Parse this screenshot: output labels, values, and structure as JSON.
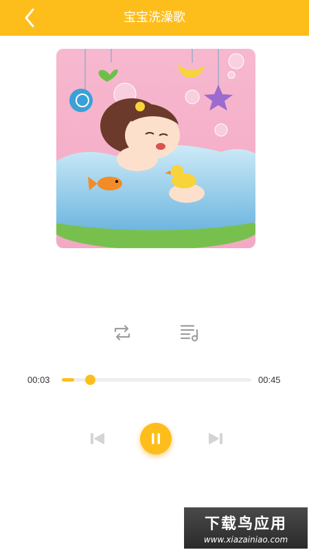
{
  "header": {
    "title": "宝宝洗澡歌",
    "back_icon": "chevron-left-icon",
    "background": "#FDBE1C"
  },
  "player": {
    "current_time": "00:03",
    "total_time": "00:45",
    "progress_fraction": 0.067,
    "accent_color": "#FDBE1C",
    "state": "playing"
  },
  "controls": {
    "repeat_icon": "repeat-icon",
    "playlist_icon": "playlist-icon",
    "prev_icon": "skip-previous-icon",
    "pause_icon": "pause-icon",
    "next_icon": "skip-next-icon"
  },
  "watermark": {
    "main": "下载鸟应用",
    "sub": "www.xiazainiao.com"
  }
}
